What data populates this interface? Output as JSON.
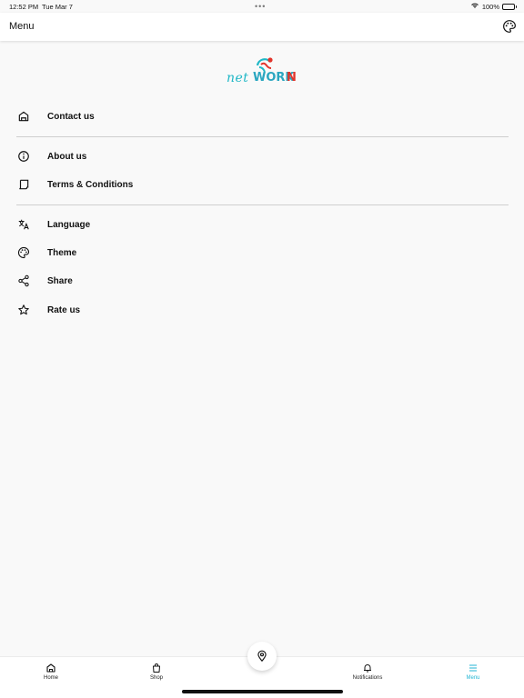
{
  "status_bar": {
    "time": "12:52 PM",
    "date": "Tue Mar 7",
    "dots": "•••",
    "battery": "100%",
    "battery_level_percent": 100
  },
  "header": {
    "title": "Menu",
    "theme_icon": "palette-icon"
  },
  "logo": {
    "net": "net",
    "work": "WORK",
    "n": "N",
    "colors": {
      "teal": "#1fb7c6",
      "red": "#e2342b"
    }
  },
  "menu": {
    "contact": {
      "label": "Contact us",
      "icon": "home-outline-icon"
    },
    "about": {
      "label": "About us",
      "icon": "info-icon"
    },
    "terms": {
      "label": "Terms & Conditions",
      "icon": "document-icon"
    },
    "language": {
      "label": "Language",
      "icon": "translate-icon"
    },
    "theme": {
      "label": "Theme",
      "icon": "palette-icon"
    },
    "share": {
      "label": "Share",
      "icon": "share-icon"
    },
    "rate": {
      "label": "Rate us",
      "icon": "star-icon"
    }
  },
  "bottom_nav": {
    "home": "Home",
    "shop": "Shop",
    "notifications": "Notifications",
    "menu": "Menu",
    "active": "Menu",
    "accent_color": "#23b6d4",
    "fab_icon": "location-pin-icon"
  }
}
